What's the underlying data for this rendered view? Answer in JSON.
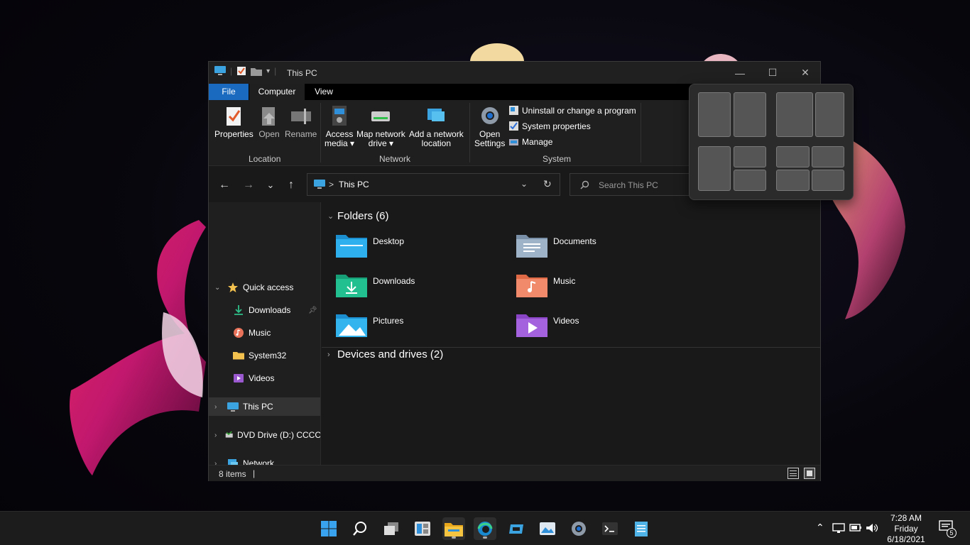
{
  "window": {
    "title": "This PC",
    "controls": {
      "minimize": "—",
      "maximize": "☐",
      "close": "✕"
    }
  },
  "ribbon_tabs": {
    "file": "File",
    "computer": "Computer",
    "view": "View"
  },
  "ribbon": {
    "properties": "Properties",
    "open": "Open",
    "rename": "Rename",
    "group_location": "Location",
    "access_media_1": "Access",
    "access_media_2": "media ▾",
    "map_drive_1": "Map network",
    "map_drive_2": "drive ▾",
    "add_location_1": "Add a network",
    "add_location_2": "location",
    "group_network": "Network",
    "open_settings_1": "Open",
    "open_settings_2": "Settings",
    "uninstall": "Uninstall or change a program",
    "system_properties": "System properties",
    "manage": "Manage",
    "group_system": "System"
  },
  "navbar": {
    "back": "←",
    "forward": "→",
    "recent": "⌄",
    "up": "↑",
    "address": "This PC",
    "address_chevron": ">",
    "search_placeholder": "Search This PC"
  },
  "navpane": {
    "quick_access": "Quick access",
    "downloads": "Downloads",
    "music": "Music",
    "system32": "System32",
    "videos": "Videos",
    "this_pc": "This PC",
    "dvd": "DVD Drive (D:) CCCC",
    "network": "Network"
  },
  "content": {
    "folders_header": "Folders (6)",
    "devices_header": "Devices and drives (2)",
    "folders": [
      "Desktop",
      "Documents",
      "Downloads",
      "Music",
      "Pictures",
      "Videos"
    ]
  },
  "status": {
    "count": "8 items",
    "caret": "|"
  },
  "clock": {
    "time": "7:28 AM",
    "day": "Friday",
    "date": "6/18/2021"
  },
  "notifications": {
    "count": "5"
  },
  "colors": {
    "accent": "#1a6bc0",
    "folder_yellow": "#f2c14e",
    "window_bg": "#191919"
  }
}
